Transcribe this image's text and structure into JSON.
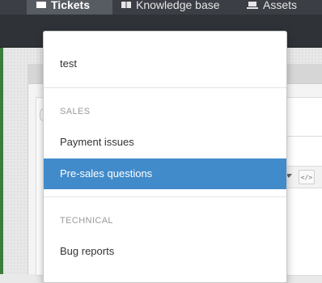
{
  "nav": {
    "tabs": [
      {
        "label": "Tickets",
        "icon": "tickets-icon"
      },
      {
        "label": "Knowledge base",
        "icon": "book-icon"
      },
      {
        "label": "Assets",
        "icon": "laptop-icon"
      }
    ]
  },
  "dropdown": {
    "items": {
      "test": "test",
      "sales_header": "SALES",
      "payment_issues": "Payment issues",
      "presales_questions": "Pre-sales questions",
      "technical_header": "TECHNICAL",
      "bug_reports": "Bug reports"
    },
    "active_item": "Pre-sales questions"
  },
  "editor": {
    "code_button_label": "</>"
  },
  "colors": {
    "nav_bg": "#3b3e44",
    "active_tab_bg": "#575b62",
    "highlight": "#428bca",
    "section_header": "#9a9a9a"
  }
}
